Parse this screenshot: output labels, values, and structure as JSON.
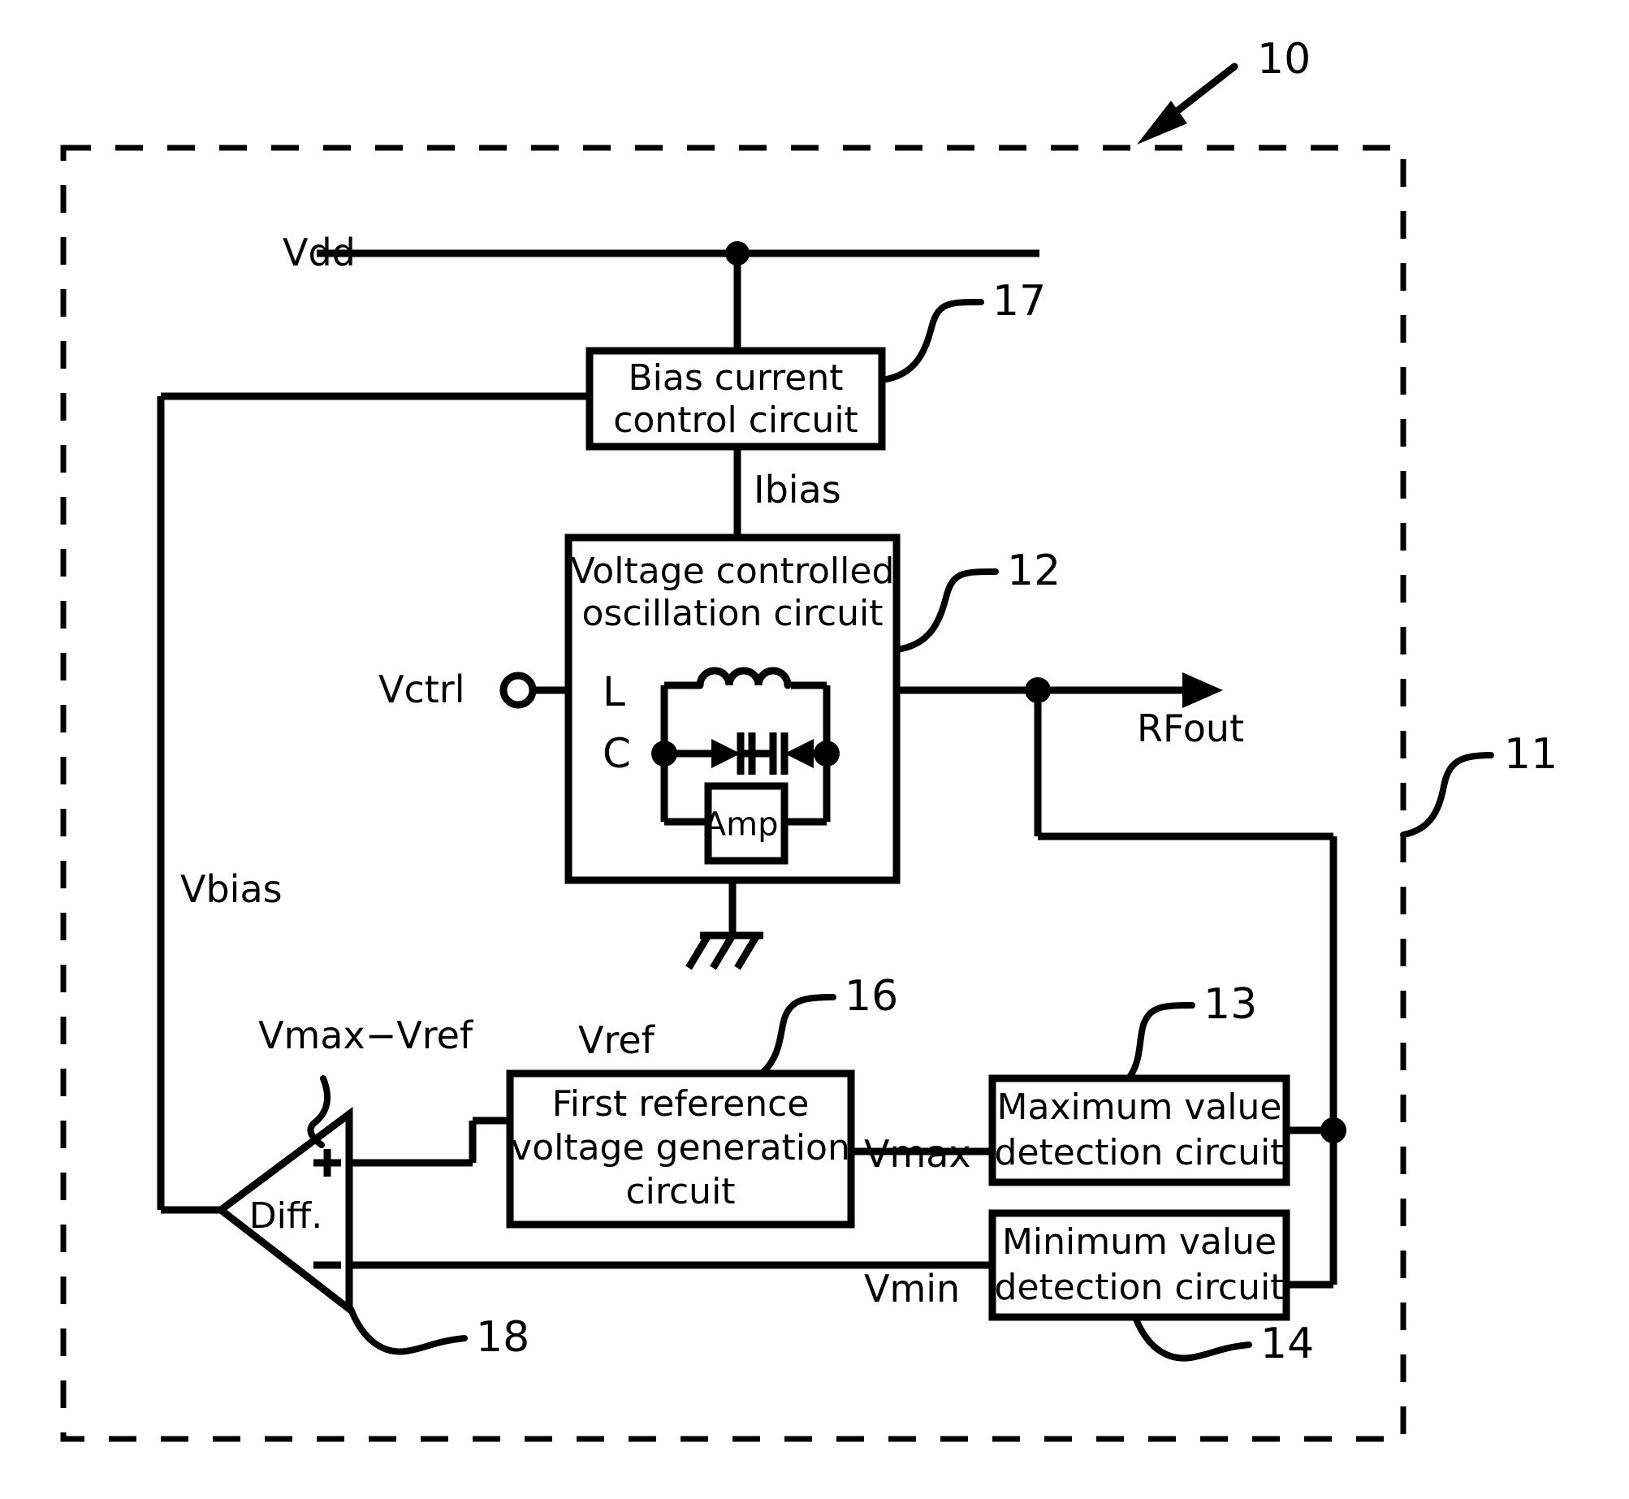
{
  "figure": {
    "type": "patent-block-diagram",
    "reference_numerals": [
      {
        "id": "10",
        "label": "10",
        "points_to": "overall-device-dashed-boundary"
      },
      {
        "id": "11",
        "label": "11",
        "points_to": "dashed-boundary-right-edge"
      },
      {
        "id": "17",
        "label": "17",
        "points_to": "bias-current-control-circuit"
      },
      {
        "id": "12",
        "label": "12",
        "points_to": "voltage-controlled-oscillation-circuit"
      },
      {
        "id": "16",
        "label": "16",
        "points_to": "first-reference-voltage-generation-circuit"
      },
      {
        "id": "13",
        "label": "13",
        "points_to": "maximum-value-detection-circuit"
      },
      {
        "id": "14",
        "label": "14",
        "points_to": "minimum-value-detection-circuit"
      },
      {
        "id": "18",
        "label": "18",
        "points_to": "differential-amplifier"
      }
    ]
  },
  "blocks": {
    "bias_current": {
      "line1": "Bias current",
      "line2": "control circuit",
      "numeral": "17"
    },
    "vco": {
      "line1": "Voltage controlled",
      "line2": "oscillation circuit",
      "numeral": "12"
    },
    "amp": {
      "label": "Amp."
    },
    "first_reference": {
      "line1": "First reference",
      "line2": "voltage generation",
      "line3": "circuit",
      "numeral": "16"
    },
    "maximum_detect": {
      "line1": "Maximum value",
      "line2": "detection circuit",
      "numeral": "13"
    },
    "minimum_detect": {
      "line1": "Minimum value",
      "line2": "detection circuit",
      "numeral": "14"
    },
    "differential": {
      "label": "Diff.",
      "plus": "+",
      "minus": "−",
      "numeral": "18"
    }
  },
  "signals": {
    "vdd": "Vdd",
    "ibias": "Ibias",
    "vctrl": "Vctrl",
    "rfout": "RFout",
    "vbias": "Vbias",
    "vref": "Vref",
    "vmax": "Vmax",
    "vmin": "Vmin",
    "vmax_minus_vref": "Vmax−Vref",
    "inductor": "L",
    "capacitor": "C"
  },
  "icons": {
    "ground": "ground-symbol",
    "terminal": "open-terminal-circle",
    "junction": "junction-dot",
    "arrow_out": "arrowhead-right",
    "inductor_coil": "inductor-coil",
    "varactor_left": "varactor-diode",
    "varactor_right": "varactor-diode",
    "device_arrow": "leader-arrow"
  },
  "style": {
    "stroke": "#000000",
    "background": "#ffffff"
  }
}
